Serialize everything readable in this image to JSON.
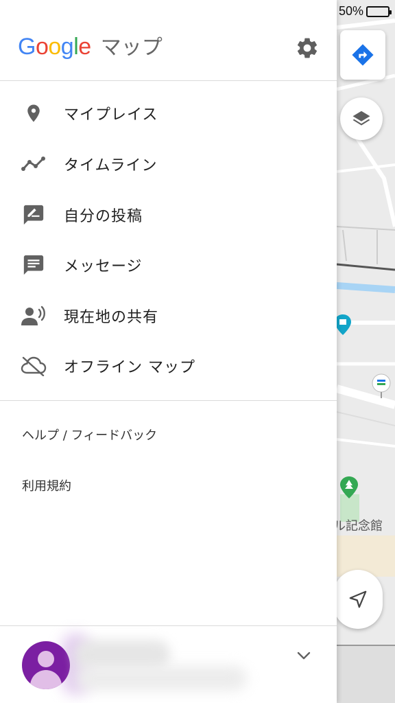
{
  "status": {
    "battery_text": "50%",
    "battery_level": 0.5
  },
  "app": {
    "logo_text": "Google",
    "logo_letters": [
      "G",
      "o",
      "o",
      "g",
      "l",
      "e"
    ],
    "logo_colors": [
      "#4285F4",
      "#EA4335",
      "#FBBC05",
      "#4285F4",
      "#34A853",
      "#EA4335"
    ],
    "title_suffix": "マップ"
  },
  "menu": {
    "items": [
      {
        "label": "マイプレイス",
        "icon": "place-pin-icon"
      },
      {
        "label": "タイムライン",
        "icon": "timeline-icon"
      },
      {
        "label": "自分の投稿",
        "icon": "contribute-icon"
      },
      {
        "label": "メッセージ",
        "icon": "message-icon"
      },
      {
        "label": "現在地の共有",
        "icon": "location-sharing-icon"
      },
      {
        "label": "オフライン マップ",
        "icon": "offline-cloud-icon"
      }
    ]
  },
  "secondary": {
    "help_feedback": "ヘルプ / フィードバック",
    "terms": "利用規約"
  },
  "map": {
    "memorial_label": "ル記念館"
  },
  "colors": {
    "icon_gray": "#616161",
    "divider": "#dadada",
    "directions_blue": "#1a73e8",
    "avatar_purple": "#7b1fa2"
  }
}
